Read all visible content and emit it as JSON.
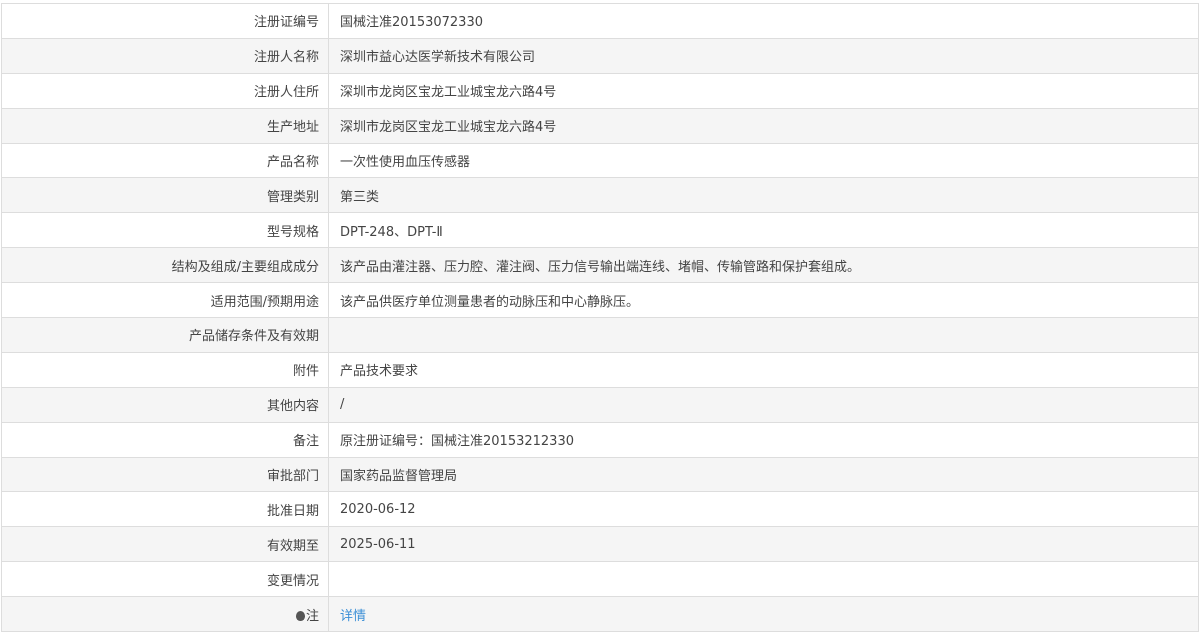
{
  "rows": [
    {
      "label": "注册证编号",
      "value": "国械注准20153072330"
    },
    {
      "label": "注册人名称",
      "value": "深圳市益心达医学新技术有限公司"
    },
    {
      "label": "注册人住所",
      "value": "深圳市龙岗区宝龙工业城宝龙六路4号"
    },
    {
      "label": "生产地址",
      "value": "深圳市龙岗区宝龙工业城宝龙六路4号"
    },
    {
      "label": "产品名称",
      "value": "一次性使用血压传感器"
    },
    {
      "label": "管理类别",
      "value": "第三类"
    },
    {
      "label": "型号规格",
      "value": "DPT-248、DPT-Ⅱ"
    },
    {
      "label": "结构及组成/主要组成成分",
      "value": "该产品由灌注器、压力腔、灌注阀、压力信号输出端连线、堵帽、传输管路和保护套组成。"
    },
    {
      "label": "适用范围/预期用途",
      "value": "该产品供医疗单位测量患者的动脉压和中心静脉压。"
    },
    {
      "label": "产品储存条件及有效期",
      "value": ""
    },
    {
      "label": "附件",
      "value": "产品技术要求"
    },
    {
      "label": "其他内容",
      "value": "/"
    },
    {
      "label": "备注",
      "value": "原注册证编号：国械注准20153212330"
    },
    {
      "label": "审批部门",
      "value": "国家药品监督管理局"
    },
    {
      "label": "批准日期",
      "value": "2020-06-12"
    },
    {
      "label": "有效期至",
      "value": "2025-06-11"
    },
    {
      "label": "变更情况",
      "value": ""
    }
  ],
  "note": {
    "label": "注",
    "icon": "lightbulb-icon",
    "link": "详情",
    "link_color": "#3b8fd6"
  }
}
